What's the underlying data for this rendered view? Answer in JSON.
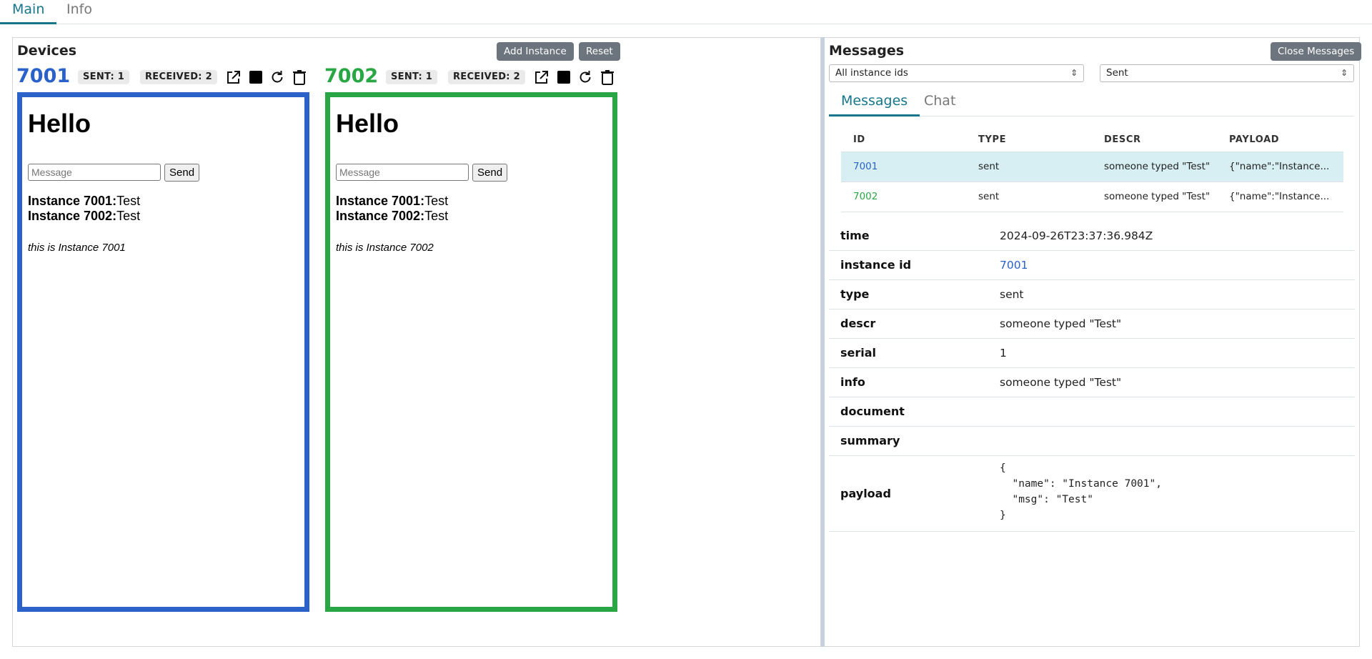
{
  "top_tabs": [
    {
      "label": "Main"
    },
    {
      "label": "Info"
    }
  ],
  "devices": {
    "title": "Devices",
    "add_instance_label": "Add Instance",
    "reset_label": "Reset",
    "instances": [
      {
        "id": "7001",
        "color": "#2a62c9",
        "sent_badge": "SENT: 1",
        "received_badge": "RECEIVED: 2",
        "heading": "Hello",
        "input_placeholder": "Message",
        "send_label": "Send",
        "lines": [
          {
            "name": "Instance 7001:",
            "text": "Test"
          },
          {
            "name": "Instance 7002:",
            "text": "Test"
          }
        ],
        "footer": "this is Instance 7001"
      },
      {
        "id": "7002",
        "color": "#28a744",
        "sent_badge": "SENT: 1",
        "received_badge": "RECEIVED: 2",
        "heading": "Hello",
        "input_placeholder": "Message",
        "send_label": "Send",
        "lines": [
          {
            "name": "Instance 7001:",
            "text": "Test"
          },
          {
            "name": "Instance 7002:",
            "text": "Test"
          }
        ],
        "footer": "this is Instance 7002"
      }
    ],
    "icons": [
      "external-link-icon",
      "stop-icon",
      "refresh-icon",
      "trash-icon"
    ]
  },
  "messages": {
    "title": "Messages",
    "close_label": "Close Messages",
    "instance_filter": "All instance ids",
    "type_filter": "Sent",
    "tabs": [
      {
        "label": "Messages"
      },
      {
        "label": "Chat"
      }
    ],
    "table": {
      "headers": [
        "ID",
        "TYPE",
        "DESCR",
        "PAYLOAD"
      ],
      "rows": [
        {
          "id": "7001",
          "id_color": "#2a62c9",
          "type": "sent",
          "descr": "someone typed \"Test\"",
          "payload": "{\"name\":\"Instance...",
          "selected": true
        },
        {
          "id": "7002",
          "id_color": "#28a744",
          "type": "sent",
          "descr": "someone typed \"Test\"",
          "payload": "{\"name\":\"Instance...",
          "selected": false
        }
      ]
    },
    "details": [
      {
        "key": "time",
        "value": "2024-09-26T23:37:36.984Z"
      },
      {
        "key": "instance id",
        "value": "7001",
        "link": true
      },
      {
        "key": "type",
        "value": "sent"
      },
      {
        "key": "descr",
        "value": "someone typed \"Test\""
      },
      {
        "key": "serial",
        "value": "1"
      },
      {
        "key": "info",
        "value": "someone typed \"Test\""
      },
      {
        "key": "document",
        "value": ""
      },
      {
        "key": "summary",
        "value": ""
      },
      {
        "key": "payload",
        "value": "{\n  \"name\": \"Instance 7001\",\n  \"msg\": \"Test\"\n}"
      }
    ]
  }
}
